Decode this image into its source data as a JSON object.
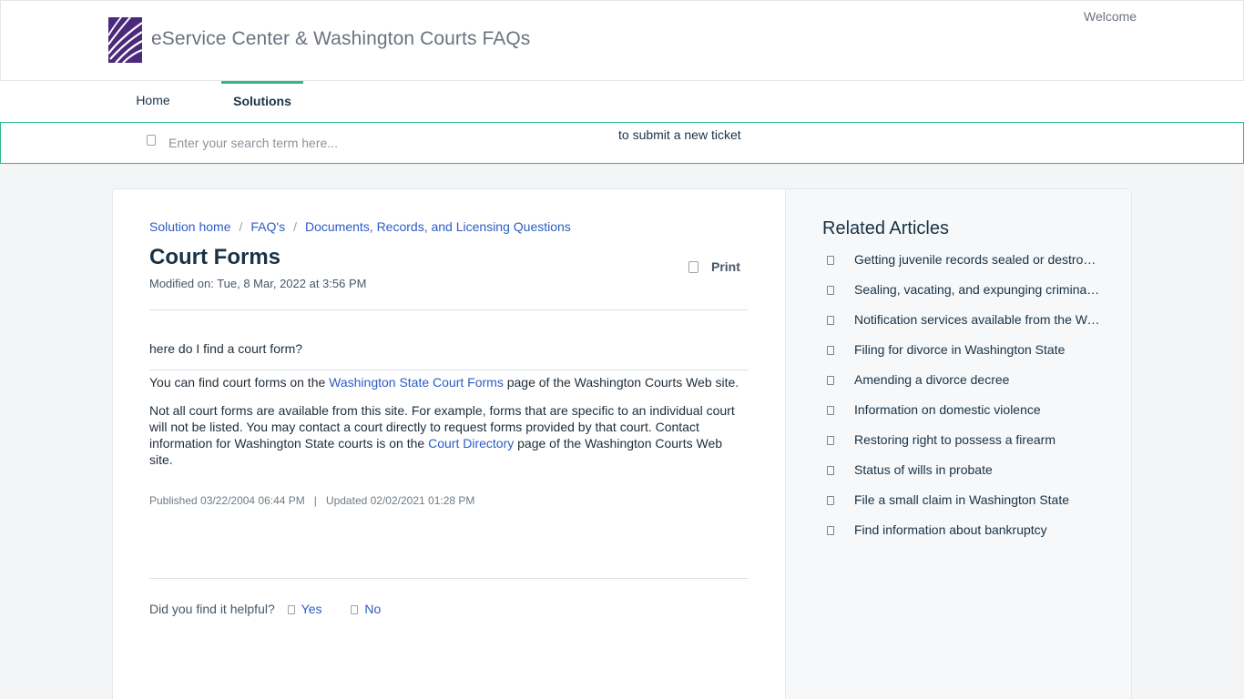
{
  "header": {
    "portal_title": "eService Center & Washington Courts FAQs",
    "welcome": "Welcome"
  },
  "nav": {
    "items": [
      {
        "label": "Home"
      },
      {
        "label": "Solutions"
      }
    ]
  },
  "search": {
    "placeholder": "Enter your search term here...",
    "value": "",
    "submit_ticket_text": "to submit a new ticket"
  },
  "article": {
    "breadcrumb": [
      "Solution home",
      "FAQ's",
      "Documents, Records, and Licensing Questions"
    ],
    "breadcrumb_separator": "/",
    "title": "Court Forms",
    "modified": "Modified on: Tue, 8 Mar, 2022 at 3:56 PM",
    "print_label": "Print",
    "question": "here do I find a court form?",
    "p1_before": "You can find court forms on the ",
    "p1_link": "Washington State Court Forms",
    "p1_after": " page of the Washington Courts Web site.",
    "p2_before": "Not all court forms are available from this site.  For example, forms that are specific to an individual court will not be listed.  You may contact a court directly to request forms provided by that court.  Contact information for Washington State courts is on the ",
    "p2_link": "Court Directory",
    "p2_after": " page of the Washington Courts Web site.",
    "published": "Published 03/22/2004 06:44 PM",
    "meta_separator": "|",
    "updated": "Updated 02/02/2021 01:28 PM",
    "helpful_question": "Did you find it helpful?",
    "yes_label": "Yes",
    "no_label": "No"
  },
  "related": {
    "title": "Related Articles",
    "items": [
      "Getting juvenile records sealed or destroyed",
      "Sealing, vacating, and expunging criminal records",
      "Notification services available from the Washington Courts",
      "Filing for divorce in Washington State",
      "Amending a divorce decree",
      "Information on domestic violence",
      "Restoring right to possess a firearm",
      "Status of wills in probate",
      "File a small claim in Washington State",
      "Find information about bankruptcy"
    ]
  },
  "colors": {
    "accent_green": "#2fb886",
    "link_blue": "#2c5cc5",
    "logo_purple": "#4b2a7b"
  }
}
